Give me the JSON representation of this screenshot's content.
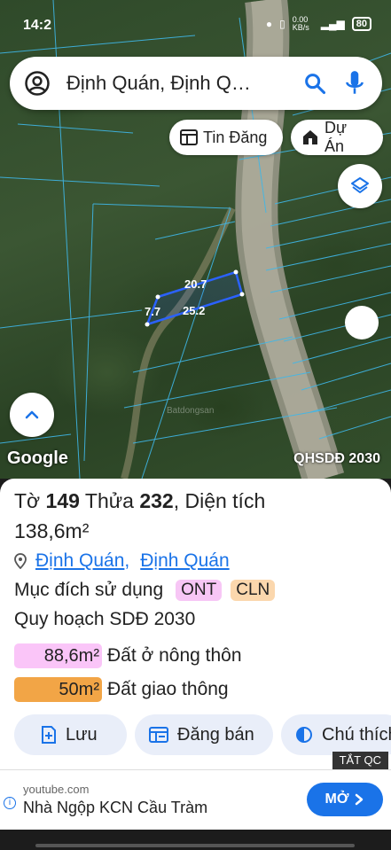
{
  "status": {
    "time": "14:2",
    "network_speed": "0.00 KB/s",
    "battery": "80"
  },
  "search": {
    "text": "Định Quán, Định Q…"
  },
  "chips": {
    "news": "Tin Đăng",
    "projects": "Dự Án"
  },
  "map": {
    "measure_top": "20.7",
    "measure_side": "7.7",
    "measure_bottom": "25.2",
    "google": "Google",
    "plan_label": "QHSDĐ 2030",
    "watermark": "Batdongsan"
  },
  "parcel": {
    "sheet_label": "Tờ",
    "sheet_no": "149",
    "lot_label": "Thửa",
    "lot_no": "232",
    "area_label": ", Diện tích",
    "area": "138,6m²",
    "location_1": "Định Quán",
    "location_sep": ",",
    "location_2": "Định Quán",
    "purpose_label": "Mục đích sử dụng",
    "tag_1": "ONT",
    "tag_2": "CLN",
    "plan_title": "Quy hoạch SDĐ 2030",
    "zone_1_area": "88,6m²",
    "zone_1_name": "Đất ở nông thôn",
    "zone_2_area": "50m²",
    "zone_2_name": "Đất giao thông"
  },
  "actions": {
    "save": "Lưu",
    "sell": "Đăng bán",
    "note": "Chú thích"
  },
  "ad": {
    "close_label": "TẮT QC",
    "url": "youtube.com",
    "title": "Nhà Ngộp KCN Cầu Tràm",
    "button": "MỞ"
  },
  "colors": {
    "accent": "#1a73e8",
    "parcel_outline": "#2b62ff",
    "ont": "#fac5f8",
    "cln": "#f2a546"
  }
}
